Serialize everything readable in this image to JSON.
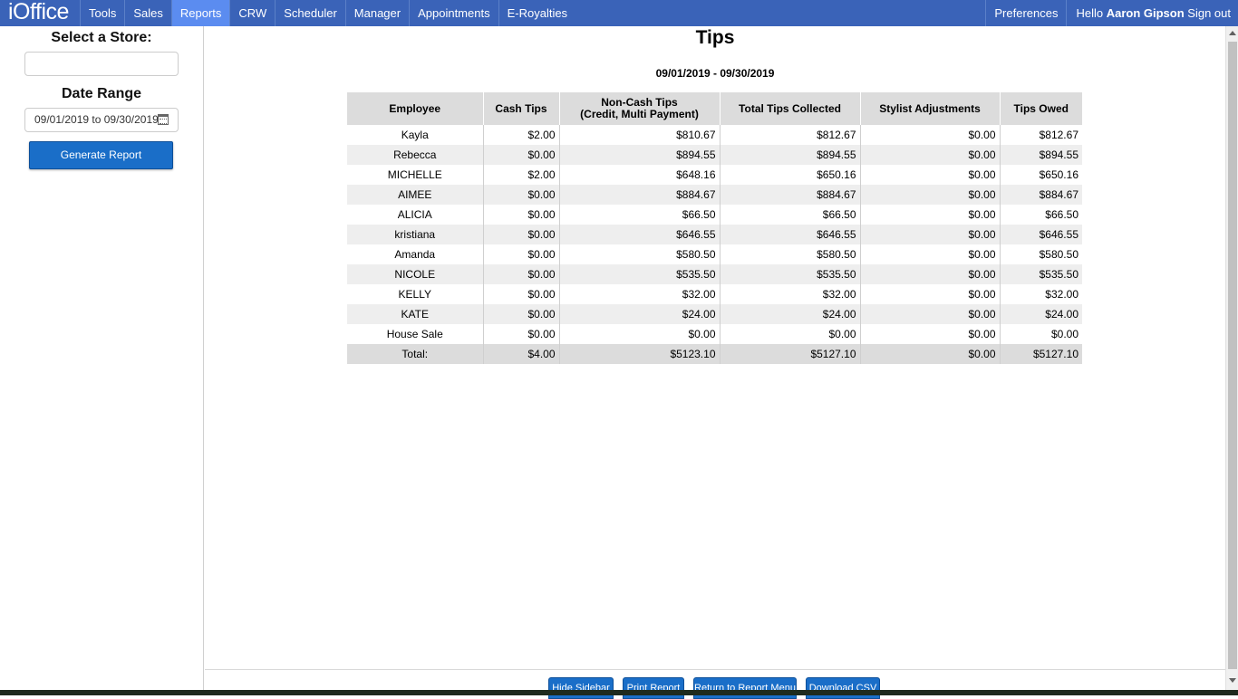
{
  "nav": {
    "logo": "iOffice",
    "items": [
      "Tools",
      "Sales",
      "Reports",
      "CRW",
      "Scheduler",
      "Manager",
      "Appointments",
      "E-Royalties"
    ],
    "active": "Reports",
    "preferences": "Preferences",
    "hello": "Hello",
    "user": "Aaron Gipson",
    "signout": "Sign out"
  },
  "sidebar": {
    "store_heading": "Select a Store:",
    "store_value": "",
    "date_heading": "Date Range",
    "date_value": "09/01/2019 to 09/30/2019",
    "generate_label": "Generate Report"
  },
  "report": {
    "title": "Tips",
    "date_range": "09/01/2019 - 09/30/2019",
    "columns": [
      "Employee",
      "Cash Tips",
      "Non-Cash Tips",
      "(Credit, Multi Payment)",
      "Total Tips Collected",
      "Stylist Adjustments",
      "Tips Owed"
    ],
    "rows": [
      [
        "Kayla",
        "$2.00",
        "$810.67",
        "$812.67",
        "$0.00",
        "$812.67"
      ],
      [
        "Rebecca",
        "$0.00",
        "$894.55",
        "$894.55",
        "$0.00",
        "$894.55"
      ],
      [
        "MICHELLE",
        "$2.00",
        "$648.16",
        "$650.16",
        "$0.00",
        "$650.16"
      ],
      [
        "AIMEE",
        "$0.00",
        "$884.67",
        "$884.67",
        "$0.00",
        "$884.67"
      ],
      [
        "ALICIA",
        "$0.00",
        "$66.50",
        "$66.50",
        "$0.00",
        "$66.50"
      ],
      [
        "kristiana",
        "$0.00",
        "$646.55",
        "$646.55",
        "$0.00",
        "$646.55"
      ],
      [
        "Amanda",
        "$0.00",
        "$580.50",
        "$580.50",
        "$0.00",
        "$580.50"
      ],
      [
        "NICOLE",
        "$0.00",
        "$535.50",
        "$535.50",
        "$0.00",
        "$535.50"
      ],
      [
        "KELLY",
        "$0.00",
        "$32.00",
        "$32.00",
        "$0.00",
        "$32.00"
      ],
      [
        "KATE",
        "$0.00",
        "$24.00",
        "$24.00",
        "$0.00",
        "$24.00"
      ],
      [
        "House Sale",
        "$0.00",
        "$0.00",
        "$0.00",
        "$0.00",
        "$0.00"
      ]
    ],
    "total": [
      "Total:",
      "$4.00",
      "$5123.10",
      "$5127.10",
      "$0.00",
      "$5127.10"
    ]
  },
  "footer": {
    "hide_sidebar": "Hide Sidebar",
    "print_report": "Print Report",
    "return_menu": "Return to Report Menu",
    "download_csv": "Download CSV"
  },
  "colors": {
    "nav_bg": "#3a63b8",
    "nav_active": "#5b8cf0",
    "button_blue": "#1a6ec8"
  }
}
